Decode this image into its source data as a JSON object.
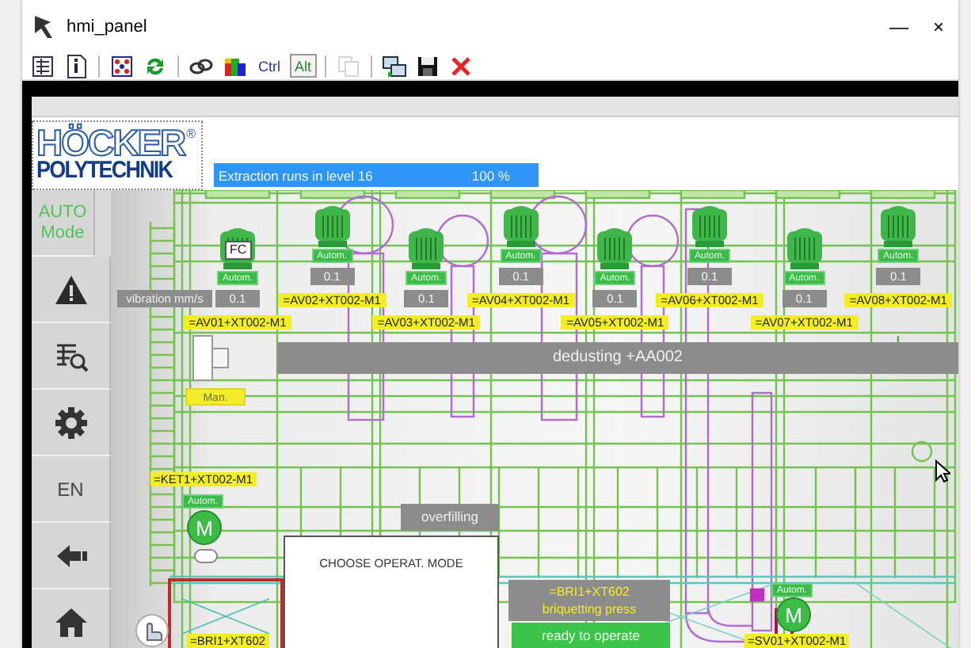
{
  "window": {
    "title": "hmi_panel",
    "controls": [
      "—",
      "×"
    ]
  },
  "toolbar": {
    "groups": [
      [
        {
          "kind": "icon",
          "disabled": false
        },
        {
          "kind": "icon",
          "disabled": false
        }
      ],
      [
        {
          "kind": "icon",
          "disabled": false
        },
        {
          "kind": "icon",
          "disabled": false
        }
      ],
      [
        {
          "kind": "icon",
          "disabled": false
        },
        {
          "kind": "icon",
          "disabled": false
        },
        {
          "kind": "key",
          "label": "Ctrl",
          "pressed": false
        },
        {
          "kind": "key",
          "label": "Alt",
          "pressed": true
        }
      ],
      [
        {
          "kind": "icon",
          "disabled": true
        }
      ],
      [
        {
          "kind": "icon",
          "disabled": false
        },
        {
          "kind": "icon",
          "disabled": false
        },
        {
          "kind": "icon",
          "disabled": false
        }
      ]
    ]
  },
  "header": {
    "logo": {
      "top": "HÖCKER",
      "bottom": "POLYTECHNIK",
      "mark": "®"
    },
    "progress": {
      "label": "Extraction runs in level 16",
      "reading": "100 %",
      "level": 1.0
    }
  },
  "sidebar": {
    "items": [
      {
        "kind": "mode",
        "label": "AUTO Mode"
      },
      {
        "kind": "icon"
      },
      {
        "kind": "icon"
      },
      {
        "kind": "icon"
      },
      {
        "kind": "text",
        "label": "EN"
      },
      {
        "kind": "icon"
      },
      {
        "kind": "icon"
      }
    ]
  },
  "plant": {
    "vibration_label": "vibration mm/s",
    "motors": [
      {
        "tag": "FC",
        "status": {
          "text": "Autom.",
          "manual": false
        },
        "reading": "0.1",
        "label": "=AV01+XT002-M1"
      },
      {
        "status": {
          "text": "Autom.",
          "manual": false
        },
        "reading": "0.1",
        "label": "=AV02+XT002-M1"
      },
      {
        "status": {
          "text": "Autom.",
          "manual": false
        },
        "reading": "0.1",
        "label": "=AV03+XT002-M1"
      },
      {
        "status": {
          "text": "Autom.",
          "manual": false
        },
        "reading": "0.1",
        "label": "=AV04+XT002-M1"
      },
      {
        "status": {
          "text": "Autom.",
          "manual": false
        },
        "reading": "0.1",
        "label": "=AV05+XT002-M1"
      },
      {
        "status": {
          "text": "Autom.",
          "manual": false
        },
        "reading": "0.1",
        "label": "=AV06+XT002-M1"
      },
      {
        "status": {
          "text": "Autom.",
          "manual": false
        },
        "reading": "0.1",
        "label": "=AV07+XT002-M1"
      },
      {
        "status": {
          "text": "Autom.",
          "manual": false
        },
        "reading": "0.1",
        "label": "=AV08+XT002-M1"
      }
    ],
    "dedusting_label": "dedusting +AA002",
    "fan": {
      "status": {
        "text": "Man.",
        "manual": true
      }
    },
    "ket1": {
      "label": "=KET1+XT002-M1",
      "status": {
        "text": "Autom.",
        "manual": false
      },
      "symbol": "M"
    },
    "overfilling": "overfilling",
    "dialog_title": "CHOOSE OPERAT. MODE",
    "bri1_label": "=BRI1+XT602",
    "press": {
      "title": "=BRI1+XT602",
      "name": "briquetting press",
      "status": "ready to operate"
    },
    "sv01": {
      "status": {
        "text": "Autom.",
        "manual": false
      },
      "symbol": "M",
      "label": "=SV01+XT002-M1"
    }
  }
}
